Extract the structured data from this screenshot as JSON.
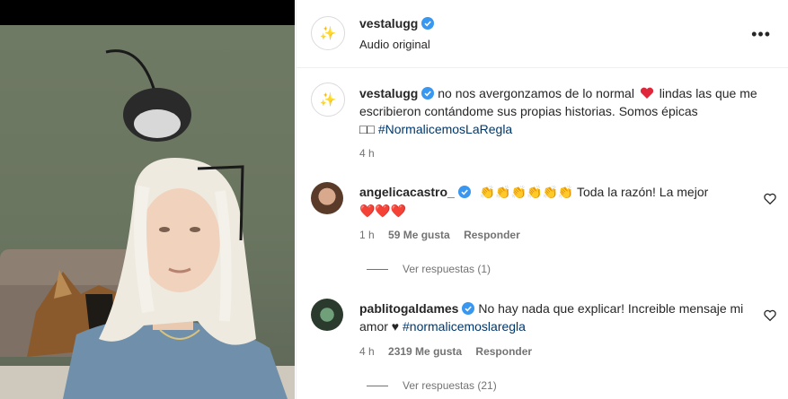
{
  "post": {
    "username": "vestalugg",
    "audio": "Audio original",
    "more_icon": "more-options-icon"
  },
  "caption": {
    "username": "vestalugg",
    "text_part1": "no nos avergonzamos de lo normal",
    "text_part2": "lindas las que me escribieron contándome sus propias historias. Somos épicas",
    "text_glyphs": "□□",
    "hashtag": "#NormalicemosLaRegla",
    "time": "4 h"
  },
  "comments": [
    {
      "username": "angelicacastro_",
      "emojis": "👏👏👏👏👏👏",
      "text": "Toda la razón! La mejor",
      "hearts": "❤️❤️❤️",
      "time": "1 h",
      "likes": "59 Me gusta",
      "reply": "Responder",
      "view_replies": "Ver respuestas (1)"
    },
    {
      "username": "pablitogaldames",
      "text": "No hay nada que explicar! Increible mensaje mi amor",
      "black_heart": "♥",
      "hashtag": "#normalicemoslaregla",
      "time": "4 h",
      "likes": "2319 Me gusta",
      "reply": "Responder",
      "view_replies": "Ver respuestas (21)"
    }
  ],
  "colors": {
    "verified": "#3897f0",
    "link": "#00376b",
    "secondary": "#737373"
  }
}
